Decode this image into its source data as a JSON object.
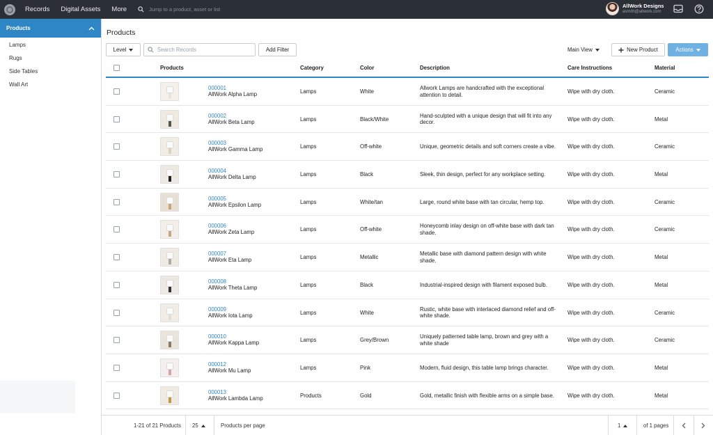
{
  "topnav": {
    "items": [
      "Records",
      "Digital Assets",
      "More"
    ],
    "search_placeholder": "Jump to a product, asset or list",
    "user_name": "AllWork Designs",
    "user_email": "asmith@allwork.com"
  },
  "sidebar": {
    "header": "Products",
    "items": [
      "Lamps",
      "Rugs",
      "Side Tables",
      "Wall Art"
    ]
  },
  "main": {
    "title": "Products",
    "level_label": "Level",
    "search_placeholder": "Search Records",
    "add_filter_label": "Add Filter",
    "main_view_label": "Main View",
    "new_product_label": "New Product",
    "actions_label": "Actions"
  },
  "table": {
    "headers": {
      "products": "Products",
      "category": "Category",
      "color": "Color",
      "description": "Description",
      "care": "Care Instructions",
      "material": "Material"
    },
    "rows": [
      {
        "id": "000001",
        "name": "AllWork Alpha Lamp",
        "category": "Lamps",
        "color": "White",
        "description": "Allwork Lamps are handcrafted with the exceptional attention to detail.",
        "care": "Wipe with dry cloth.",
        "material": "Ceramic"
      },
      {
        "id": "000002",
        "name": "AllWork Beta Lamp",
        "category": "Lamps",
        "color": "Black/White",
        "description": "Hand-sculpted with a unique design that will fit into any decor.",
        "care": "Wipe with dry cloth.",
        "material": "Metal"
      },
      {
        "id": "000003",
        "name": "AllWork Gamma Lamp",
        "category": "Lamps",
        "color": "Off-white",
        "description": "Unique, geometric details and soft corners create a vibe.",
        "care": "Wipe with dry cloth.",
        "material": "Ceramic"
      },
      {
        "id": "000004",
        "name": "AllWork Delta Lamp",
        "category": "Lamps",
        "color": "Black",
        "description": "Sleek, thin design, perfect for any workplace setting.",
        "care": "Wipe with dry cloth.",
        "material": "Metal"
      },
      {
        "id": "000005",
        "name": "AllWork Epsilon Lamp",
        "category": "Lamps",
        "color": "White/tan",
        "description": "Large, round white base with tan circular, hemp top.",
        "care": "Wipe with dry cloth.",
        "material": "Ceramic"
      },
      {
        "id": "000006",
        "name": "AllWork Zeta Lamp",
        "category": "Lamps",
        "color": "Off-white",
        "description": "Honeycomb inlay design on off-white base with dark tan shade.",
        "care": "Wipe with dry cloth.",
        "material": "Ceramic"
      },
      {
        "id": "000007",
        "name": "AllWork Eta Lamp",
        "category": "Lamps",
        "color": "Metallic",
        "description": "Metallic base with diamond pattern design with white shade.",
        "care": "Wipe with dry cloth.",
        "material": "Metal"
      },
      {
        "id": "000008",
        "name": "AllWork Theta Lamp",
        "category": "Lamps",
        "color": "Black",
        "description": "Industrial-inspired design with filament exposed bulb.",
        "care": "Wipe with dry cloth.",
        "material": "Metal"
      },
      {
        "id": "000009",
        "name": "AllWork Iota Lamp",
        "category": "Lamps",
        "color": "White",
        "description": "Rustic, white base with interlaced diamond relief and off-white shade.",
        "care": "Wipe with dry cloth.",
        "material": "Ceramic"
      },
      {
        "id": "000010",
        "name": "AllWork Kappa Lamp",
        "category": "Lamps",
        "color": "Grey/Brown",
        "description": "Uniquely patterned table lamp, brown and grey with a white shade",
        "care": "Wipe with dry cloth.",
        "material": "Ceramic"
      },
      {
        "id": "000012",
        "name": "AllWork Mu Lamp",
        "category": "Lamps",
        "color": "Pink",
        "description": "Modern, fluid design, this table lamp brings character.",
        "care": "Wipe with dry cloth.",
        "material": "Metal"
      },
      {
        "id": "000013",
        "name": "AllWork Lambda Lamp",
        "category": "Products",
        "color": "Gold",
        "description": "Gold, metallic finish with flexible arms on a simple base.",
        "care": "Wipe with dry cloth.",
        "material": "Metal"
      }
    ]
  },
  "footer": {
    "range": "1-21 of 21 Products",
    "per_page_value": "25",
    "per_page_label": "Products per page",
    "page_value": "1",
    "page_total": "of 1 pages"
  },
  "colors": {
    "accent": "#2f86c7",
    "nav_bg": "#2b2f36",
    "actions_bg": "#6fb1e3"
  }
}
